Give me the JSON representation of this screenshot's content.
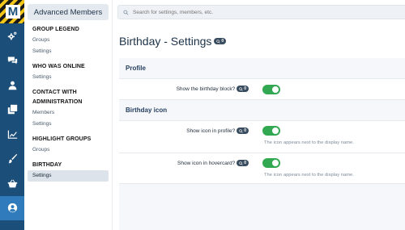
{
  "search": {
    "placeholder": "Search for settings, members, etc."
  },
  "rail": {
    "icons": [
      "logo-icon",
      "cogs-icon",
      "comments-icon",
      "user-icon",
      "clone-icon",
      "chart-line-icon",
      "brush-icon",
      "basket-icon",
      "user-circle-icon"
    ],
    "active": "user-circle-icon"
  },
  "sidebar": {
    "header": "Advanced Members",
    "groups": [
      {
        "title": "GROUP LEGEND",
        "links": [
          "Groups",
          "Settings"
        ]
      },
      {
        "title": "WHO WAS ONLINE",
        "links": [
          "Settings"
        ]
      },
      {
        "title": "CONTACT WITH ADMINISTRATION",
        "links": [
          "Members",
          "Settings"
        ]
      },
      {
        "title": "HIGHLIGHT GROUPS",
        "links": [
          "Groups"
        ]
      },
      {
        "title": "BIRTHDAY",
        "links": [
          "Settings"
        ]
      }
    ]
  },
  "main": {
    "title": "Birthday - Settings",
    "title_badge": "0",
    "sections": [
      {
        "heading": "Profile",
        "rows": [
          {
            "label": "Show the birthday block?",
            "badge": "0",
            "enabled": true,
            "hint": ""
          }
        ]
      },
      {
        "heading": "Birthday icon",
        "rows": [
          {
            "label": "Show icon in profile?",
            "badge": "0",
            "enabled": true,
            "hint": "The icon appears next to the display name."
          },
          {
            "label": "Show icon in hovercard?",
            "badge": "0",
            "enabled": true,
            "hint": "The icon appears next to the display name."
          }
        ]
      }
    ]
  },
  "colors": {
    "rail": "#1b4f7a",
    "rail_active": "#2f7bbb",
    "toggle_on": "#32a852",
    "badge": "#3a4c5f"
  }
}
